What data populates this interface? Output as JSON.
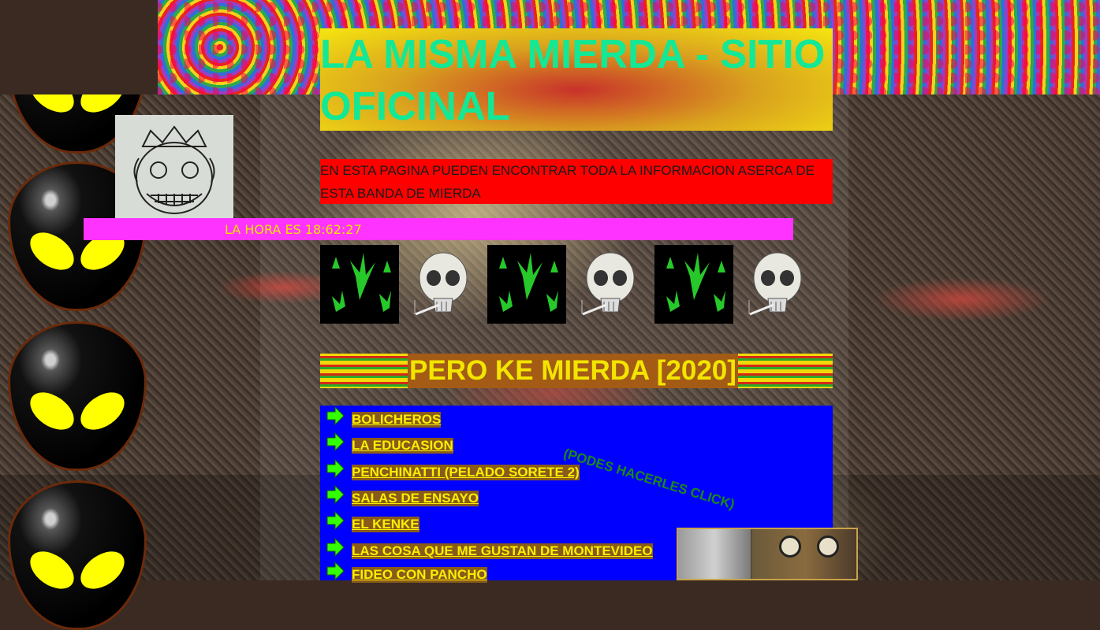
{
  "header": {
    "title": "LA MISMA MIERDA - SITIO OFICINAL"
  },
  "intro": {
    "text": "EN ESTA PAGINA PUEDEN ENCONTRAR TODA LA INFORMACION ASERCA DE ESTA BANDA DE MIERDA"
  },
  "clock": {
    "text": "LA HORA ES 18:62:27"
  },
  "gifs": [
    "weed-leaves-icon",
    "smoking-skull-icon",
    "weed-leaves-icon",
    "smoking-skull-icon",
    "weed-leaves-icon",
    "smoking-skull-icon"
  ],
  "section": {
    "heading": "PERO KE MIERDA [2020]"
  },
  "links": {
    "hint": "(PODES HACERLES CLICK)",
    "items": [
      "BOLICHEROS",
      "LA EDUCASION",
      "PENCHINATTI (PELADO SORETE 2)",
      "SALAS DE ENSAYO",
      "EL KENKE",
      "LAS COSA QUE ME GUSTAN DE MONTEVIDEO",
      "FIDEO CON PANCHO"
    ]
  },
  "colors": {
    "title_text": "#12e895",
    "intro_bg": "#ff0000",
    "clock_bar": "#ff33ff",
    "clock_text": "#f2e200",
    "links_bg": "#0000ff",
    "link_text": "#f7f000",
    "arrow": "#33ff00"
  }
}
